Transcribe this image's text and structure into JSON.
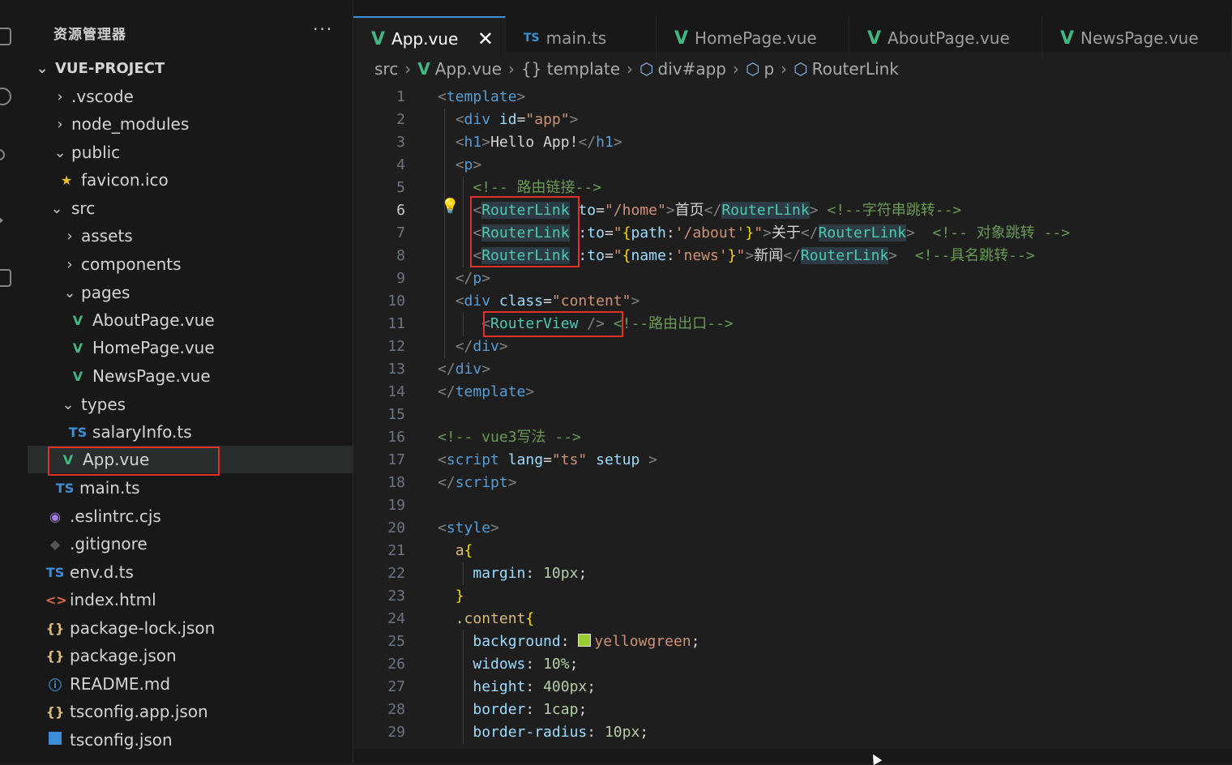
{
  "explorer": {
    "title": "资源管理器",
    "more": "···",
    "root": "VUE-PROJECT",
    "items": [
      {
        "label": ".vscode",
        "icon": "chevron-right"
      },
      {
        "label": "node_modules",
        "icon": "chevron-right"
      },
      {
        "label": "public",
        "icon": "chevron-down"
      },
      {
        "label": "favicon.ico",
        "icon": "star-icon"
      },
      {
        "label": "src",
        "icon": "chevron-down"
      },
      {
        "label": "assets",
        "icon": "chevron-right"
      },
      {
        "label": "components",
        "icon": "chevron-right"
      },
      {
        "label": "pages",
        "icon": "chevron-down"
      },
      {
        "label": "AboutPage.vue",
        "icon": "vue-icon"
      },
      {
        "label": "HomePage.vue",
        "icon": "vue-icon"
      },
      {
        "label": "NewsPage.vue",
        "icon": "vue-icon"
      },
      {
        "label": "types",
        "icon": "chevron-down"
      },
      {
        "label": "salaryInfo.ts",
        "icon": "ts-icon"
      },
      {
        "label": "App.vue",
        "icon": "vue-icon"
      },
      {
        "label": "main.ts",
        "icon": "ts-icon"
      },
      {
        "label": ".eslintrc.cjs",
        "icon": "eslint-icon"
      },
      {
        "label": ".gitignore",
        "icon": "git-icon"
      },
      {
        "label": "env.d.ts",
        "icon": "ts-icon"
      },
      {
        "label": "index.html",
        "icon": "html-icon"
      },
      {
        "label": "package-lock.json",
        "icon": "json-icon"
      },
      {
        "label": "package.json",
        "icon": "json-icon"
      },
      {
        "label": "README.md",
        "icon": "info-icon"
      },
      {
        "label": "tsconfig.app.json",
        "icon": "json-icon"
      },
      {
        "label": "tsconfig.json",
        "icon": "tsconfig-icon"
      }
    ]
  },
  "tabs": [
    {
      "label": "App.vue",
      "icon": "vue-icon",
      "active": true,
      "close": "✕"
    },
    {
      "label": "main.ts",
      "icon": "ts-icon"
    },
    {
      "label": "HomePage.vue",
      "icon": "vue-icon"
    },
    {
      "label": "AboutPage.vue",
      "icon": "vue-icon"
    },
    {
      "label": "NewsPage.vue",
      "icon": "vue-icon"
    }
  ],
  "icon_glyphs": {
    "vue": "V",
    "ts": "TS",
    "json": "{}",
    "html": "<>",
    "info": "ⓘ",
    "star": "★",
    "cube": "⬡"
  },
  "breadcrumb": [
    "src",
    "App.vue",
    "{} template",
    "div#app",
    "p",
    "RouterLink"
  ],
  "editor": {
    "current_line": 6,
    "line_numbers": [
      "1",
      "2",
      "3",
      "4",
      "5",
      "6",
      "7",
      "8",
      "9",
      "10",
      "11",
      "12",
      "13",
      "14",
      "15",
      "16",
      "17",
      "18",
      "19",
      "20",
      "21",
      "22",
      "23",
      "24",
      "25",
      "26",
      "27",
      "28",
      "29"
    ],
    "code": {
      "l5_comment": "<!-- 路由链接-->",
      "l6_text": "首页",
      "l6_comment": "<!--字符串跳转-->",
      "l7_text": "关于",
      "l7_comment": "<!-- 对象跳转 -->",
      "l8_text": "新闻",
      "l8_comment": "<!--具名跳转-->",
      "l11_comment": "<!--路由出口-->",
      "l16_comment": "<!-- vue3写法 -->",
      "l25_value": "yellowgreen",
      "l26_value": "10%",
      "l27_value": "400px",
      "l28_value": "1cap",
      "l29_value": "10px"
    }
  },
  "colors": {
    "accent": "#3c8fd6",
    "vue": "#41b883",
    "highlight_box": "#e0302a"
  }
}
